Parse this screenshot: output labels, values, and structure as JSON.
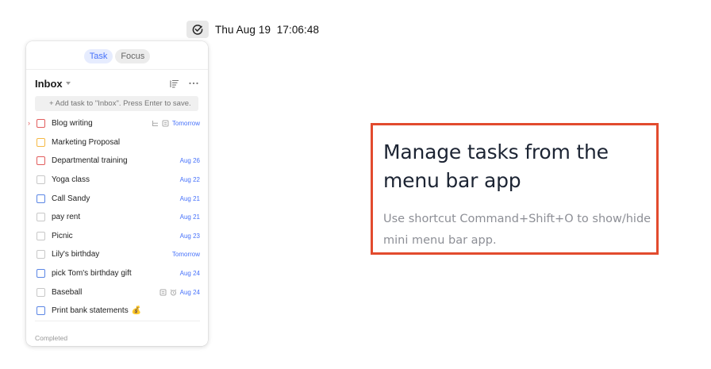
{
  "menubar": {
    "icon": "checkmark-circle-icon",
    "clock": "Thu Aug 19  17:06:48"
  },
  "popup": {
    "tabs": [
      {
        "label": "Task",
        "active": true
      },
      {
        "label": "Focus",
        "active": false
      }
    ],
    "list_title": "Inbox",
    "add_placeholder": "+ Add task to \"Inbox\". Press Enter to save.",
    "tasks": [
      {
        "title": "Blog writing",
        "date": "Tomorrow",
        "priority_color": "#e25d5d",
        "icons": [
          "subtask-icon",
          "note-icon"
        ],
        "expanded_arrow": true
      },
      {
        "title": "Marketing Proposal",
        "date": "",
        "priority_color": "#f5b944",
        "icons": []
      },
      {
        "title": "Departmental training",
        "date": "Aug 26",
        "priority_color": "#e25d5d",
        "icons": []
      },
      {
        "title": "Yoga class",
        "date": "Aug 22",
        "priority_color": "#c8c8c8",
        "icons": []
      },
      {
        "title": "Call Sandy",
        "date": "Aug 21",
        "priority_color": "#5b86e5",
        "icons": []
      },
      {
        "title": "pay rent",
        "date": "Aug 21",
        "priority_color": "#c8c8c8",
        "icons": []
      },
      {
        "title": "Picnic",
        "date": "Aug 23",
        "priority_color": "#c8c8c8",
        "icons": []
      },
      {
        "title": "Lily's birthday",
        "date": "Tomorrow",
        "priority_color": "#c8c8c8",
        "icons": []
      },
      {
        "title": "pick Tom's birthday gift",
        "date": "Aug 24",
        "priority_color": "#5b86e5",
        "icons": []
      },
      {
        "title": "Baseball",
        "date": "Aug 24",
        "priority_color": "#c8c8c8",
        "icons": [
          "note-icon",
          "alarm-icon"
        ]
      },
      {
        "title": "Print bank statements",
        "emoji": "💰",
        "date": "",
        "priority_color": "#5b86e5",
        "icons": []
      }
    ],
    "completed_label": "Completed"
  },
  "callout": {
    "heading": "Manage tasks from the menu bar app",
    "body": "Use shortcut Command+Shift+O to show/hide mini menu bar app.",
    "border_color": "#e24b2e"
  }
}
